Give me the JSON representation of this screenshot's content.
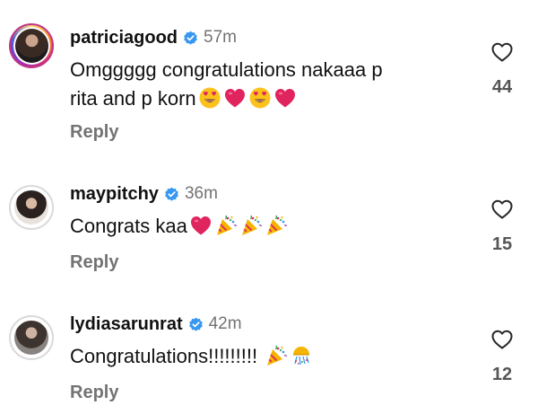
{
  "comments": [
    {
      "username": "patriciagood",
      "time": "57m",
      "text_line1": "Omggggg congratulations nakaaa p",
      "text_line2": "rita and p korn",
      "emojis": [
        "heart-eyes-emoji",
        "red-heart-emoji",
        "heart-eyes-emoji",
        "red-heart-emoji"
      ],
      "reply_label": "Reply",
      "like_count": "44"
    },
    {
      "username": "maypitchy",
      "time": "36m",
      "text": "Congrats kaa",
      "emojis": [
        "red-heart-emoji",
        "party-popper-emoji",
        "party-popper-emoji",
        "party-popper-emoji"
      ],
      "reply_label": "Reply",
      "like_count": "15"
    },
    {
      "username": "lydiasarunrat",
      "time": "42m",
      "text": "Congratulations!!!!!!!!!",
      "emojis": [
        "party-popper-emoji",
        "confetti-ball-emoji"
      ],
      "reply_label": "Reply",
      "like_count": "12"
    }
  ],
  "colors": {
    "verified": "#3897f0",
    "muted": "#737373",
    "heart": "#e0245e"
  }
}
